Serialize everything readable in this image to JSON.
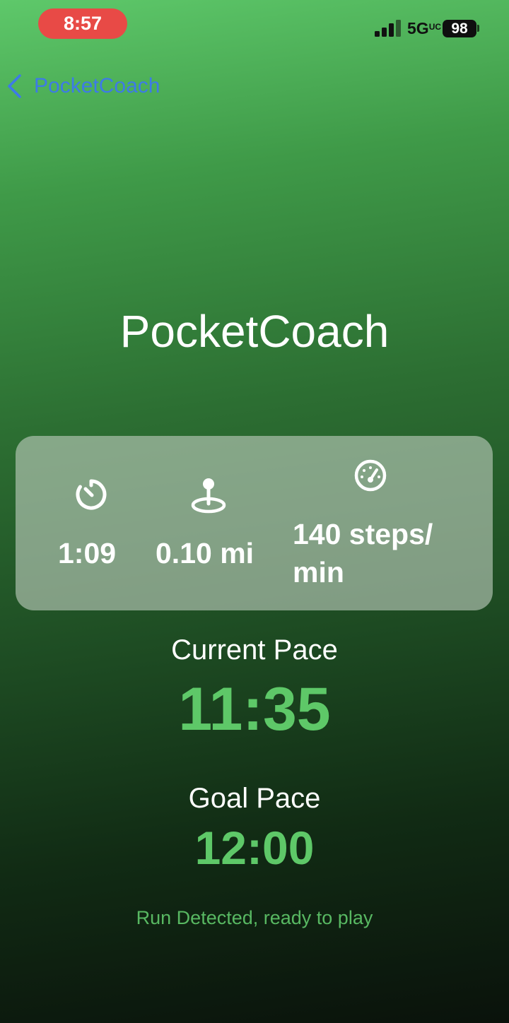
{
  "status_bar": {
    "time": "8:57",
    "network": "5G",
    "network_sup": "UC",
    "battery": "98"
  },
  "nav": {
    "back_label": "PocketCoach"
  },
  "app_title": "PocketCoach",
  "stats": {
    "elapsed_time": "1:09",
    "distance": "0.10 mi",
    "cadence": "140 steps/ min"
  },
  "current_pace": {
    "label": "Current Pace",
    "value": "11:35"
  },
  "goal_pace": {
    "label": "Goal Pace",
    "value": "12:00"
  },
  "run_status": "Run Detected, ready to play",
  "colors": {
    "pace_green": "#5ec868",
    "time_pill_red": "#e84a46",
    "back_blue": "#3d7ae8"
  }
}
